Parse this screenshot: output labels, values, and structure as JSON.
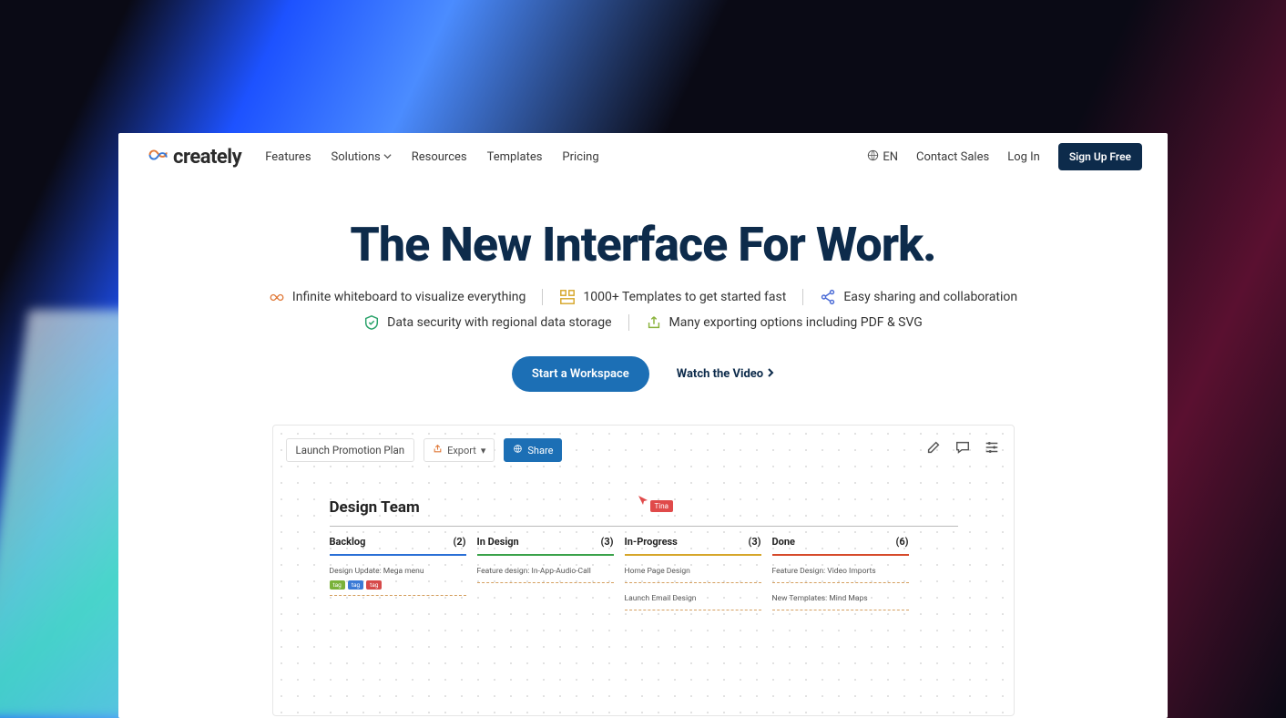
{
  "brand": "creately",
  "nav": {
    "items": [
      "Features",
      "Solutions",
      "Resources",
      "Templates",
      "Pricing"
    ],
    "lang": "EN",
    "contact": "Contact Sales",
    "login": "Log In",
    "signup": "Sign Up Free"
  },
  "hero": {
    "title": "The New Interface For Work.",
    "features": [
      "Infinite whiteboard to visualize everything",
      "1000+ Templates to get started fast",
      "Easy sharing and collaboration",
      "Data security with regional data storage",
      "Many exporting options including PDF & SVG"
    ],
    "cta_primary": "Start a Workspace",
    "cta_video": "Watch the Video"
  },
  "mock": {
    "title": "Launch Promotion Plan",
    "export": "Export",
    "share": "Share",
    "board_title": "Design Team",
    "cursor_user": "Tina",
    "columns": [
      {
        "name": "Backlog",
        "count": "(2)",
        "color": "c-blue",
        "cards": [
          {
            "text": "Design Update: Mega menu",
            "tags": [
              "g",
              "b",
              "r"
            ]
          }
        ]
      },
      {
        "name": "In Design",
        "count": "(3)",
        "color": "c-green",
        "cards": [
          {
            "text": "Feature design: In-App-Audio-Call"
          }
        ]
      },
      {
        "name": "In-Progress",
        "count": "(3)",
        "color": "c-yellow",
        "cards": [
          {
            "text": "Home Page Design"
          },
          {
            "text": "Launch Email Design"
          }
        ]
      },
      {
        "name": "Done",
        "count": "(6)",
        "color": "c-red",
        "cards": [
          {
            "text": "Feature Design: Video Imports"
          },
          {
            "text": "New Templates: Mind Maps"
          }
        ]
      }
    ]
  }
}
